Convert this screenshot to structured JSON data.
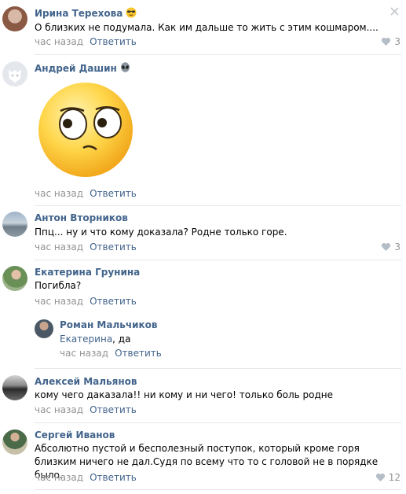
{
  "comments": [
    {
      "name": "Ирина Терехова",
      "text": "О близких не подумала. Как им дальше то жить с этим кошмаром....",
      "time": "час назад",
      "reply": "Ответить",
      "likes": "3"
    },
    {
      "name": "Андрей Дашин",
      "time": "час назад",
      "reply": "Ответить"
    },
    {
      "name": "Антон Вторников",
      "text": "Ппц... ну и что кому доказала? Родне только горе.",
      "time": "час назад",
      "reply": "Ответить",
      "likes": "3"
    },
    {
      "name": "Екатерина Грунина",
      "text": "Погибла?",
      "time": "час назад",
      "reply": "Ответить"
    },
    {
      "name": "Роман Мальчиков",
      "mention": "Екатерина",
      "text": ", да",
      "time": "час назад",
      "reply": "Ответить"
    },
    {
      "name": "Алексей Мальянов",
      "text": "кому чего даказала!! ни кому и ни чего! только боль родне",
      "time": "час назад",
      "reply": "Ответить"
    },
    {
      "name": "Сергей Иванов",
      "text": "Абсолютно пустой и бесполезный поступок, который кроме горя близким ничего не дал.Судя по всему что то с головой не в порядке было.",
      "time": "час назад",
      "reply": "Ответить",
      "likes": "12"
    }
  ],
  "colors": {
    "link": "#42648b",
    "muted": "#939393",
    "divider": "#e7e8ec"
  }
}
